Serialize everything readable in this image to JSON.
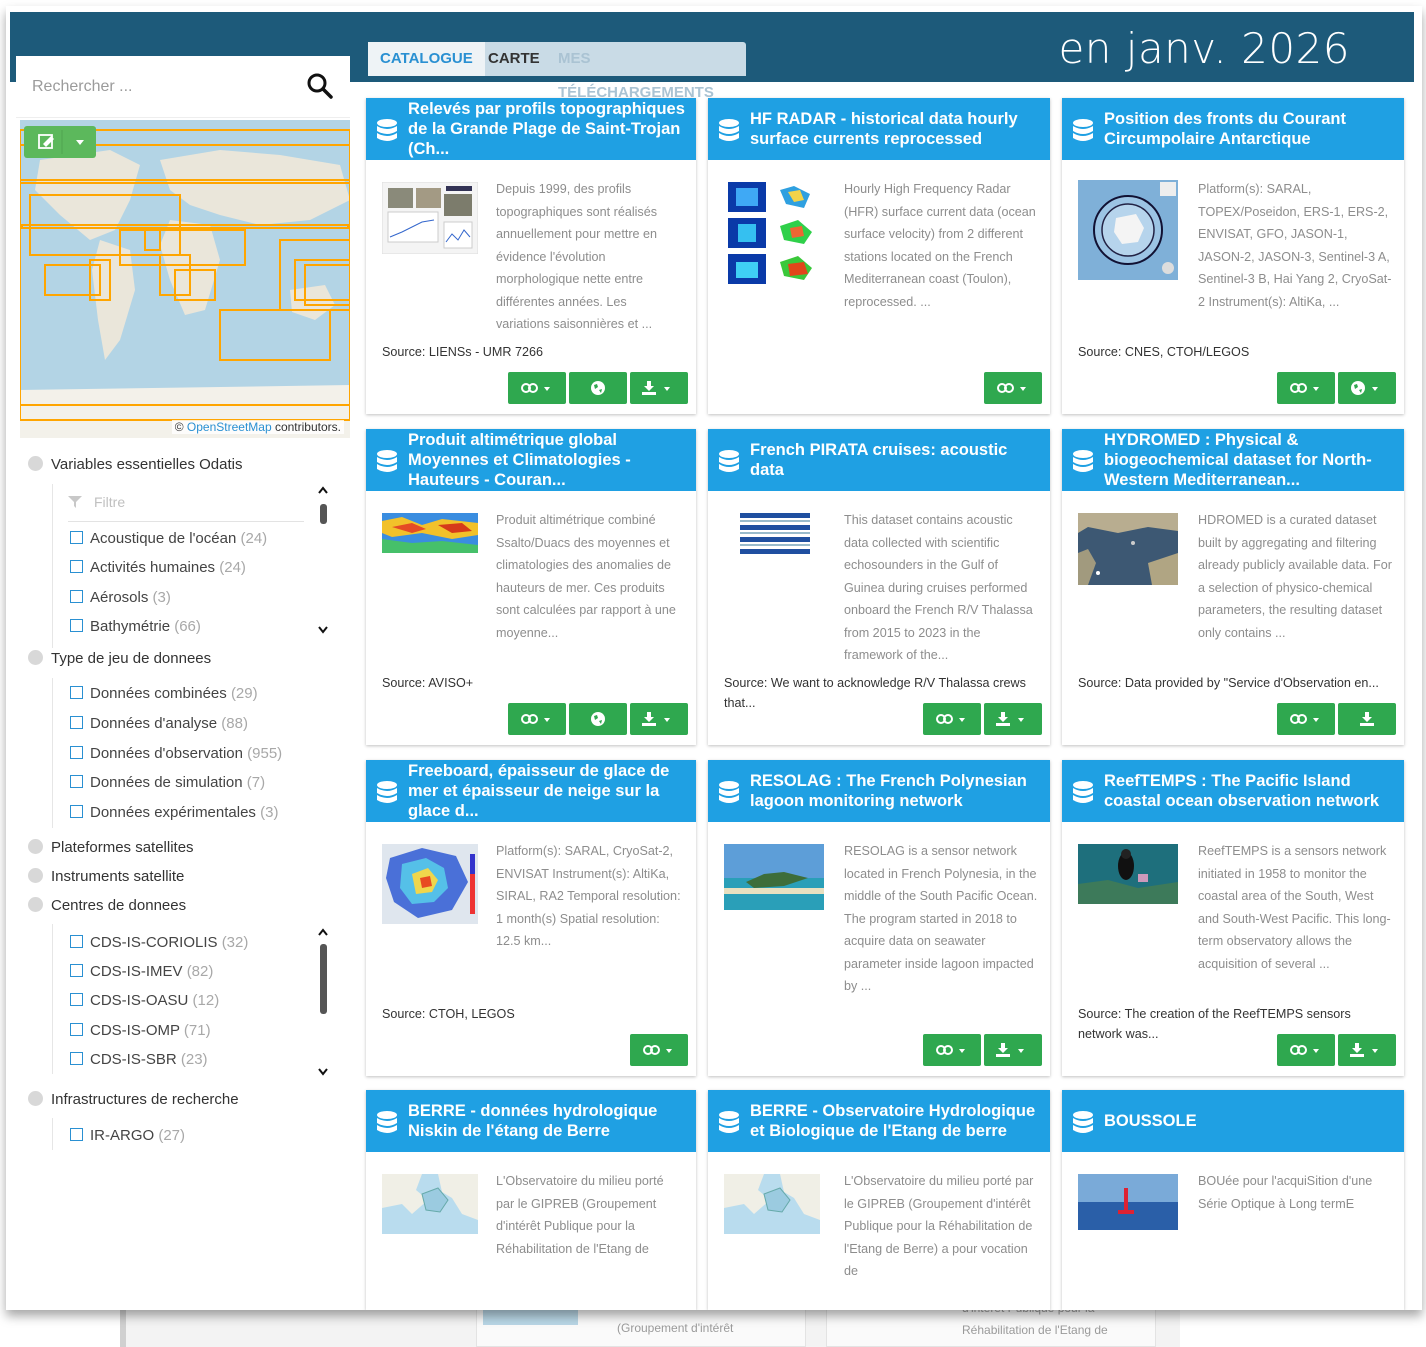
{
  "date_label": "en janv. 2026",
  "tabs": [
    {
      "label": "CATALOGUE"
    },
    {
      "label": "CARTE"
    },
    {
      "label": "MES TÉLÉCHARGEMENTS"
    }
  ],
  "search": {
    "placeholder": "Rechercher ..."
  },
  "map": {
    "attribution_link": "OpenStreetMap",
    "attribution_text": " contributors.",
    "copyright": "© "
  },
  "filters": {
    "filter_placeholder": "Filtre",
    "groups": [
      {
        "label": "Variables essentielles Odatis"
      },
      {
        "label": "Type de jeu de donnees"
      },
      {
        "label": "Plateformes satellites"
      },
      {
        "label": "Instruments satellite"
      },
      {
        "label": "Centres de donnees"
      },
      {
        "label": "Infrastructures de recherche"
      }
    ],
    "variables": [
      {
        "label": "Acoustique de l'océan",
        "count": "(24)"
      },
      {
        "label": "Activités humaines",
        "count": "(24)"
      },
      {
        "label": "Aérosols",
        "count": "(3)"
      },
      {
        "label": "Bathymétrie",
        "count": "(66)"
      }
    ],
    "types": [
      {
        "label": "Données combinées",
        "count": "(29)"
      },
      {
        "label": "Données d'analyse",
        "count": "(88)"
      },
      {
        "label": "Données d'observation",
        "count": "(955)"
      },
      {
        "label": "Données de simulation",
        "count": "(7)"
      },
      {
        "label": "Données expérimentales",
        "count": "(3)"
      }
    ],
    "centres": [
      {
        "label": "CDS-IS-CORIOLIS",
        "count": "(32)"
      },
      {
        "label": "CDS-IS-IMEV",
        "count": "(82)"
      },
      {
        "label": "CDS-IS-OASU",
        "count": "(12)"
      },
      {
        "label": "CDS-IS-OMP",
        "count": "(71)"
      },
      {
        "label": "CDS-IS-SBR",
        "count": "(23)"
      }
    ],
    "infrastructures": [
      {
        "label": "IR-ARGO",
        "count": "(27)"
      }
    ]
  },
  "cards": [
    {
      "title": "Relevés par profils topographiques de la Grande Plage de Saint-Trojan (Ch...",
      "desc": "Depuis 1999, des profils topographiques sont réalisés annuellement pour mettre en évidence l'évolution morphologique nette entre différentes années. Les variations saisonnières et ...",
      "source": "Source: LIENSs - UMR 7266"
    },
    {
      "title": "HF RADAR - historical data hourly surface currents reprocessed",
      "desc": "Hourly High Frequency Radar (HFR) surface current data (ocean surface velocity) from 2 different stations located on the French Mediterranean coast (Toulon), reprocessed. ...",
      "source": ""
    },
    {
      "title": "Position des fronts du Courant Circumpolaire Antarctique",
      "desc": "Platform(s): SARAL, TOPEX/Poseidon, ERS-1, ERS-2, ENVISAT, GFO, JASON-1, JASON-2, JASON-3, Sentinel-3 A, Sentinel-3 B, Hai Yang 2, CryoSat-2 Instrument(s): AltiKa, ...",
      "source": "Source: CNES, CTOH/LEGOS"
    },
    {
      "title": "Produit altimétrique global Moyennes et Climatologies - Hauteurs - Couran...",
      "desc": "Produit altimétrique combiné Ssalto/Duacs des moyennes et climatologies des anomalies de hauteurs de mer. Ces produits sont calculées par rapport à une moyenne...",
      "source": "Source: AVISO+"
    },
    {
      "title": "French PIRATA cruises: acoustic data",
      "desc": "This dataset contains acoustic data collected with scientific echosounders in the Gulf of Guinea during cruises performed onboard the French R/V Thalassa from 2015 to 2023 in the framework of the...",
      "source": "Source: We want to acknowledge R/V Thalassa crews that..."
    },
    {
      "title": "HYDROMED : Physical & biogeochemical dataset for North-Western Mediterranean...",
      "desc": "HDROMED is a curated dataset built by aggregating and filtering already publicly available data. For a selection of physico-chemical parameters, the resulting dataset only contains ...",
      "source": "Source: Data provided by \"Service d'Observation en..."
    },
    {
      "title": "Freeboard, épaisseur de glace de mer et épaisseur de neige sur la glace d...",
      "desc": "Platform(s): SARAL, CryoSat-2, ENVISAT Instrument(s): AltiKa, SIRAL, RA2 Temporal resolution: 1 month(s) Spatial resolution: 12.5 km...",
      "source": "Source: CTOH, LEGOS"
    },
    {
      "title": "RESOLAG : The French Polynesian lagoon monitoring network",
      "desc": "RESOLAG is a sensor network located in French Polynesia, in the middle of the South Pacific Ocean. The program started in 2018 to acquire data on seawater parameter inside lagoon impacted by ...",
      "source": ""
    },
    {
      "title": "ReefTEMPS : The Pacific Island coastal ocean observation network",
      "desc": "ReefTEMPS is a sensors network initiated in 1958 to monitor the coastal area of the South, West and South-West Pacific. This long-term observatory allows the acquisition of several ...",
      "source": "Source: The creation of the ReefTEMPS sensors network was..."
    },
    {
      "title": "BERRE - données hydrologique Niskin de l'étang de Berre",
      "desc": "L'Observatoire du milieu porté par le GIPREB (Groupement d'intérêt Publique pour la Réhabilitation de l'Etang de",
      "source": ""
    },
    {
      "title": "BERRE - Observatoire Hydrologique et Biologique de l'Etang de berre",
      "desc": "L'Observatoire du milieu porté par le GIPREB (Groupement d'intérêt Publique pour la Réhabilitation de l'Etang de Berre) a pour vocation de",
      "source": ""
    },
    {
      "title": "BOUSSOLE",
      "desc": "BOUée pour l'acquiSition d'une Série Optique à Long termE",
      "source": ""
    }
  ],
  "ghost": {
    "text1": "(Groupement d'intérêt",
    "text2": "Réhabilitation de l'Etang de",
    "text3": "d'intérêt Publique pour la"
  }
}
